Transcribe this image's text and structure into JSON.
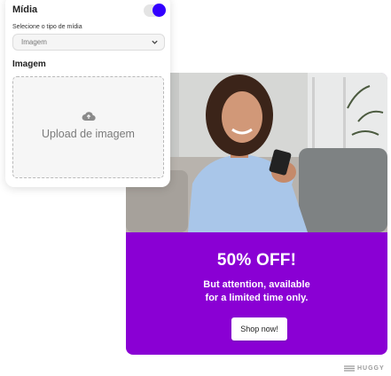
{
  "panel": {
    "media_title": "Mídia",
    "toggle_on": true,
    "select_label": "Selecione o tipo de mídia",
    "select_value": "Imagem",
    "image_label": "Imagem",
    "upload_text": "Upload de imagem"
  },
  "promo": {
    "title": "50% OFF!",
    "subtitle_line1": "But attention, available",
    "subtitle_line2": "for a limited time only.",
    "button_label": "Shop now!"
  },
  "brand": {
    "watermark": "HUGGY"
  },
  "colors": {
    "accent": "#3300ff",
    "promo_background": "#8a00d4",
    "sweater": "#a9c6e9"
  }
}
